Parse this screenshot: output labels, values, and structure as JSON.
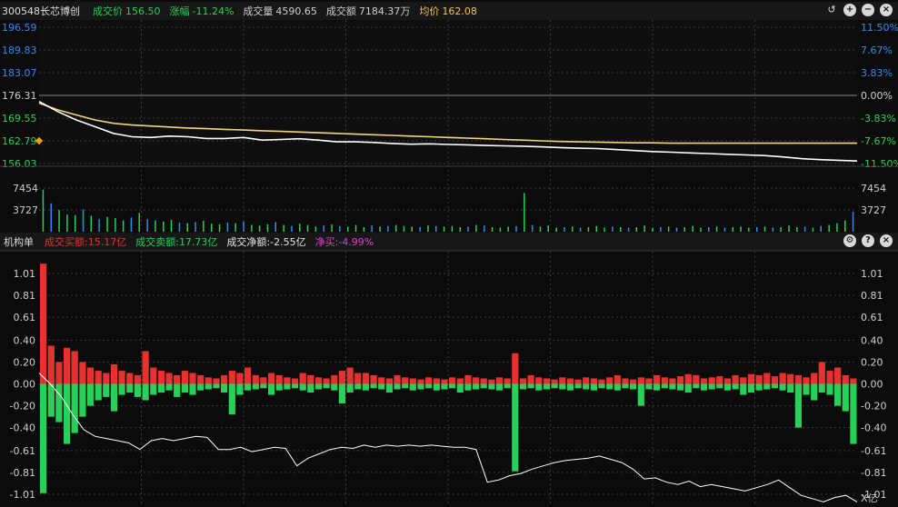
{
  "top_header": {
    "code_name": "300548长芯博创",
    "price_label": "成交价",
    "price_value": "156.50",
    "change_label": "涨幅",
    "change_value": "-11.24%",
    "volume_label": "成交量",
    "volume_value": "4590.65",
    "amount_label": "成交额",
    "amount_value": "7184.37万",
    "avg_label": "均价",
    "avg_value": "162.08"
  },
  "bottom_header": {
    "title": "机构单",
    "buy_label": "成交买额:",
    "buy_value": "15.17亿",
    "sell_label": "成交卖额:",
    "sell_value": "17.73亿",
    "net_label": "成交净额:",
    "net_value": "-2.55亿",
    "netbuy_label": "净买:",
    "netbuy_value": "-4.99%"
  },
  "top_buttons": [
    "refresh-icon",
    "zoom-in-icon",
    "minimize-icon",
    "close-icon"
  ],
  "bottom_buttons": [
    "settings-icon",
    "help-icon",
    "close-icon"
  ],
  "colors": {
    "up": "#e8302f",
    "down": "#27d058",
    "price_line": "#ffffff",
    "avg_line": "#f3d67a",
    "blue": "#2f8cf0",
    "magenta": "#e53bd6",
    "yellow_text": "#f0c84a"
  },
  "chart_data": [
    {
      "type": "line",
      "title": "",
      "y_left_ticks": [
        "196.59",
        "189.83",
        "183.07",
        "176.31",
        "169.55",
        "162.79",
        "156.03"
      ],
      "y_right_ticks": [
        "11.50%",
        "7.67%",
        "3.83%",
        "0.00%",
        "-3.83%",
        "-7.67%",
        "-11.50%"
      ],
      "ylim": [
        156.03,
        196.59
      ],
      "series": [
        {
          "name": "price",
          "values": [
            174.5,
            171.5,
            169.0,
            167.0,
            165.0,
            164.0,
            163.8,
            164.2,
            164.0,
            163.5,
            163.5,
            163.8,
            163.0,
            163.2,
            163.4,
            163.0,
            162.5,
            162.5,
            162.3,
            162.0,
            161.8,
            161.9,
            161.7,
            161.6,
            161.4,
            161.3,
            161.2,
            161.0,
            160.8,
            160.6,
            160.5,
            160.2,
            159.9,
            159.6,
            159.4,
            159.2,
            159.0,
            158.8,
            158.6,
            158.4,
            158.0,
            157.5,
            157.2,
            157.0,
            156.8
          ]
        },
        {
          "name": "avg",
          "values": [
            174.0,
            172.0,
            170.5,
            169.0,
            168.0,
            167.5,
            167.2,
            166.9,
            166.6,
            166.4,
            166.2,
            166.0,
            165.8,
            165.6,
            165.4,
            165.2,
            165.0,
            164.8,
            164.6,
            164.4,
            164.2,
            164.0,
            163.8,
            163.6,
            163.4,
            163.2,
            163.0,
            162.8,
            162.6,
            162.5,
            162.4,
            162.3,
            162.2,
            162.2,
            162.1,
            162.1,
            162.1,
            162.1,
            162.1,
            162.1,
            162.1,
            162.1,
            162.1,
            162.1,
            162.1
          ]
        }
      ]
    },
    {
      "type": "bar",
      "title": "",
      "y_ticks": [
        "7454",
        "3727"
      ],
      "ylim": [
        0,
        11181
      ],
      "values": [
        7400,
        5000,
        3800,
        3000,
        2900,
        3900,
        2800,
        2200,
        2600,
        2400,
        2000,
        2500,
        3300,
        2200,
        2000,
        1800,
        2100,
        1600,
        1500,
        1700,
        1900,
        1400,
        1300,
        1600,
        1500,
        1800,
        1200,
        1100,
        1300,
        1700,
        1200,
        1000,
        1400,
        1200,
        900,
        1100,
        1300,
        1000,
        900,
        1200,
        800,
        1100,
        900,
        1000,
        1200,
        1000,
        900,
        800,
        1100,
        1000,
        900,
        1000,
        800,
        900,
        1200,
        1100,
        800,
        700,
        900,
        1000,
        6800,
        1200,
        900,
        1100,
        700,
        800,
        900,
        700,
        800,
        1000,
        700,
        900,
        800,
        700,
        800,
        1100,
        700,
        800,
        900,
        700,
        800,
        1000,
        700,
        800,
        900,
        700,
        800,
        900,
        700,
        800,
        900,
        700,
        800,
        1100,
        800,
        900,
        700,
        1000,
        1200,
        1500,
        2000,
        3500
      ]
    },
    {
      "type": "bar",
      "title": "",
      "y_ticks": [
        "1.01",
        "0.81",
        "0.61",
        "0.40",
        "0.20",
        "0.00",
        "-0.20",
        "-0.40",
        "-0.61",
        "-0.81",
        "-1.01"
      ],
      "unit_label": "X亿",
      "ylim": [
        -1.11,
        1.21
      ],
      "series": [
        {
          "name": "buy",
          "values": [
            1.1,
            0.35,
            0.2,
            0.33,
            0.3,
            0.2,
            0.15,
            0.12,
            0.1,
            0.18,
            0.12,
            0.1,
            0.08,
            0.3,
            0.15,
            0.12,
            0.1,
            0.08,
            0.12,
            0.1,
            0.08,
            0.06,
            0.05,
            0.08,
            0.12,
            0.1,
            0.15,
            0.08,
            0.06,
            0.1,
            0.08,
            0.06,
            0.05,
            0.1,
            0.08,
            0.06,
            0.05,
            0.08,
            0.12,
            0.15,
            0.1,
            0.1,
            0.08,
            0.06,
            0.05,
            0.08,
            0.06,
            0.05,
            0.04,
            0.06,
            0.05,
            0.04,
            0.06,
            0.05,
            0.08,
            0.06,
            0.05,
            0.04,
            0.06,
            0.05,
            0.28,
            0.05,
            0.08,
            0.06,
            0.05,
            0.04,
            0.06,
            0.05,
            0.04,
            0.06,
            0.05,
            0.04,
            0.06,
            0.08,
            0.05,
            0.04,
            0.06,
            0.05,
            0.08,
            0.06,
            0.05,
            0.07,
            0.09,
            0.08,
            0.05,
            0.06,
            0.07,
            0.05,
            0.08,
            0.06,
            0.09,
            0.08,
            0.1,
            0.07,
            0.1,
            0.09,
            0.08,
            0.06,
            0.1,
            0.2,
            0.12,
            0.15,
            0.08,
            0.05
          ]
        },
        {
          "name": "sell",
          "values": [
            -1.0,
            -0.3,
            -0.35,
            -0.55,
            -0.45,
            -0.3,
            -0.2,
            -0.15,
            -0.12,
            -0.25,
            -0.1,
            -0.08,
            -0.12,
            -0.15,
            -0.1,
            -0.08,
            -0.06,
            -0.12,
            -0.08,
            -0.1,
            -0.06,
            -0.05,
            -0.04,
            -0.08,
            -0.28,
            -0.1,
            -0.06,
            -0.05,
            -0.04,
            -0.1,
            -0.06,
            -0.05,
            -0.04,
            -0.06,
            -0.08,
            -0.05,
            -0.04,
            -0.06,
            -0.18,
            -0.08,
            -0.05,
            -0.06,
            -0.04,
            -0.05,
            -0.08,
            -0.05,
            -0.04,
            -0.06,
            -0.05,
            -0.04,
            -0.06,
            -0.05,
            -0.04,
            -0.08,
            -0.06,
            -0.05,
            -0.04,
            -0.05,
            -0.06,
            -0.04,
            -0.8,
            -0.05,
            -0.04,
            -0.06,
            -0.05,
            -0.04,
            -0.05,
            -0.06,
            -0.04,
            -0.05,
            -0.06,
            -0.04,
            -0.05,
            -0.06,
            -0.04,
            -0.05,
            -0.2,
            -0.05,
            -0.06,
            -0.04,
            -0.05,
            -0.06,
            -0.08,
            -0.04,
            -0.06,
            -0.05,
            -0.04,
            -0.06,
            -0.05,
            -0.1,
            -0.08,
            -0.06,
            -0.05,
            -0.04,
            -0.06,
            -0.08,
            -0.4,
            -0.1,
            -0.15,
            -0.08,
            -0.1,
            -0.2,
            -0.25,
            -0.55
          ]
        },
        {
          "name": "cumulative_net",
          "values": [
            0.1,
            0.0,
            -0.12,
            -0.28,
            -0.42,
            -0.48,
            -0.5,
            -0.52,
            -0.54,
            -0.6,
            -0.52,
            -0.5,
            -0.52,
            -0.5,
            -0.48,
            -0.49,
            -0.6,
            -0.6,
            -0.58,
            -0.62,
            -0.6,
            -0.58,
            -0.59,
            -0.75,
            -0.68,
            -0.64,
            -0.6,
            -0.58,
            -0.59,
            -0.56,
            -0.58,
            -0.56,
            -0.57,
            -0.56,
            -0.57,
            -0.56,
            -0.57,
            -0.58,
            -0.58,
            -0.6,
            -0.9,
            -0.88,
            -0.84,
            -0.82,
            -0.78,
            -0.75,
            -0.72,
            -0.7,
            -0.69,
            -0.68,
            -0.66,
            -0.69,
            -0.72,
            -0.78,
            -0.87,
            -0.86,
            -0.9,
            -0.92,
            -0.89,
            -0.94,
            -0.92,
            -0.94,
            -0.96,
            -0.98,
            -0.95,
            -0.92,
            -0.88,
            -0.95,
            -1.02,
            -1.05,
            -1.08,
            -1.04,
            -1.02,
            -1.08
          ]
        }
      ]
    }
  ]
}
